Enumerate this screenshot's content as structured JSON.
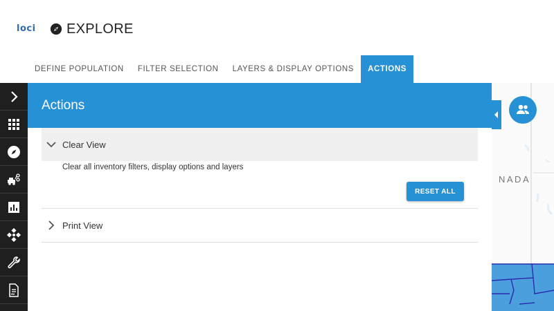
{
  "app": {
    "logo_text": "loci",
    "page_title": "EXPLORE"
  },
  "tabs": [
    {
      "label": "DEFINE POPULATION",
      "active": false
    },
    {
      "label": "FILTER SELECTION",
      "active": false
    },
    {
      "label": "LAYERS & DISPLAY OPTIONS",
      "active": false
    },
    {
      "label": "ACTIONS",
      "active": true
    }
  ],
  "sidebar": {
    "items": [
      {
        "icon": "chevron-right-icon"
      },
      {
        "icon": "grid-icon"
      },
      {
        "icon": "compass-icon"
      },
      {
        "icon": "vehicle-network-icon"
      },
      {
        "icon": "bar-chart-icon"
      },
      {
        "icon": "network-diamond-icon"
      },
      {
        "icon": "wrench-icon"
      },
      {
        "icon": "report-icon"
      }
    ]
  },
  "panel": {
    "title": "Actions",
    "sections": [
      {
        "label": "Clear View",
        "expanded": true,
        "description": "Clear all inventory filters, display options and layers",
        "button_label": "RESET ALL"
      },
      {
        "label": "Print View",
        "expanded": false
      }
    ]
  },
  "map": {
    "label": "NADA"
  },
  "colors": {
    "accent": "#2691d4",
    "sidebar_bg": "#1f1f1f",
    "map_fill": "#4a9fdc",
    "map_border": "#2b2bb0"
  }
}
